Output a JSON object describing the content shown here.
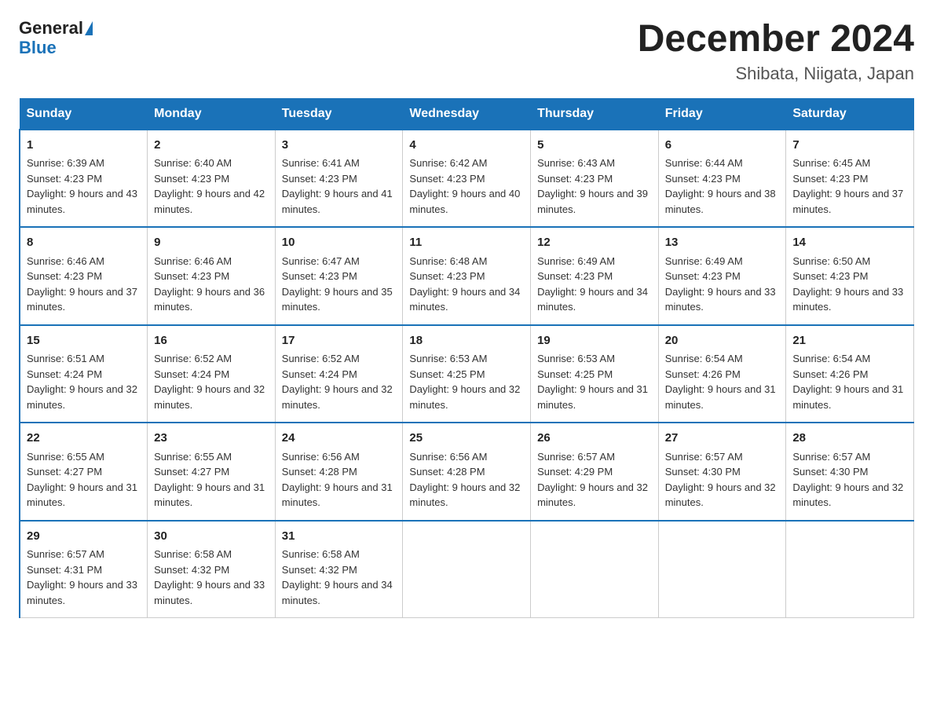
{
  "header": {
    "logo_general": "General",
    "logo_blue": "Blue",
    "title": "December 2024",
    "subtitle": "Shibata, Niigata, Japan"
  },
  "days_of_week": [
    "Sunday",
    "Monday",
    "Tuesday",
    "Wednesday",
    "Thursday",
    "Friday",
    "Saturday"
  ],
  "weeks": [
    [
      {
        "day": "1",
        "sunrise": "6:39 AM",
        "sunset": "4:23 PM",
        "daylight": "9 hours and 43 minutes."
      },
      {
        "day": "2",
        "sunrise": "6:40 AM",
        "sunset": "4:23 PM",
        "daylight": "9 hours and 42 minutes."
      },
      {
        "day": "3",
        "sunrise": "6:41 AM",
        "sunset": "4:23 PM",
        "daylight": "9 hours and 41 minutes."
      },
      {
        "day": "4",
        "sunrise": "6:42 AM",
        "sunset": "4:23 PM",
        "daylight": "9 hours and 40 minutes."
      },
      {
        "day": "5",
        "sunrise": "6:43 AM",
        "sunset": "4:23 PM",
        "daylight": "9 hours and 39 minutes."
      },
      {
        "day": "6",
        "sunrise": "6:44 AM",
        "sunset": "4:23 PM",
        "daylight": "9 hours and 38 minutes."
      },
      {
        "day": "7",
        "sunrise": "6:45 AM",
        "sunset": "4:23 PM",
        "daylight": "9 hours and 37 minutes."
      }
    ],
    [
      {
        "day": "8",
        "sunrise": "6:46 AM",
        "sunset": "4:23 PM",
        "daylight": "9 hours and 37 minutes."
      },
      {
        "day": "9",
        "sunrise": "6:46 AM",
        "sunset": "4:23 PM",
        "daylight": "9 hours and 36 minutes."
      },
      {
        "day": "10",
        "sunrise": "6:47 AM",
        "sunset": "4:23 PM",
        "daylight": "9 hours and 35 minutes."
      },
      {
        "day": "11",
        "sunrise": "6:48 AM",
        "sunset": "4:23 PM",
        "daylight": "9 hours and 34 minutes."
      },
      {
        "day": "12",
        "sunrise": "6:49 AM",
        "sunset": "4:23 PM",
        "daylight": "9 hours and 34 minutes."
      },
      {
        "day": "13",
        "sunrise": "6:49 AM",
        "sunset": "4:23 PM",
        "daylight": "9 hours and 33 minutes."
      },
      {
        "day": "14",
        "sunrise": "6:50 AM",
        "sunset": "4:23 PM",
        "daylight": "9 hours and 33 minutes."
      }
    ],
    [
      {
        "day": "15",
        "sunrise": "6:51 AM",
        "sunset": "4:24 PM",
        "daylight": "9 hours and 32 minutes."
      },
      {
        "day": "16",
        "sunrise": "6:52 AM",
        "sunset": "4:24 PM",
        "daylight": "9 hours and 32 minutes."
      },
      {
        "day": "17",
        "sunrise": "6:52 AM",
        "sunset": "4:24 PM",
        "daylight": "9 hours and 32 minutes."
      },
      {
        "day": "18",
        "sunrise": "6:53 AM",
        "sunset": "4:25 PM",
        "daylight": "9 hours and 32 minutes."
      },
      {
        "day": "19",
        "sunrise": "6:53 AM",
        "sunset": "4:25 PM",
        "daylight": "9 hours and 31 minutes."
      },
      {
        "day": "20",
        "sunrise": "6:54 AM",
        "sunset": "4:26 PM",
        "daylight": "9 hours and 31 minutes."
      },
      {
        "day": "21",
        "sunrise": "6:54 AM",
        "sunset": "4:26 PM",
        "daylight": "9 hours and 31 minutes."
      }
    ],
    [
      {
        "day": "22",
        "sunrise": "6:55 AM",
        "sunset": "4:27 PM",
        "daylight": "9 hours and 31 minutes."
      },
      {
        "day": "23",
        "sunrise": "6:55 AM",
        "sunset": "4:27 PM",
        "daylight": "9 hours and 31 minutes."
      },
      {
        "day": "24",
        "sunrise": "6:56 AM",
        "sunset": "4:28 PM",
        "daylight": "9 hours and 31 minutes."
      },
      {
        "day": "25",
        "sunrise": "6:56 AM",
        "sunset": "4:28 PM",
        "daylight": "9 hours and 32 minutes."
      },
      {
        "day": "26",
        "sunrise": "6:57 AM",
        "sunset": "4:29 PM",
        "daylight": "9 hours and 32 minutes."
      },
      {
        "day": "27",
        "sunrise": "6:57 AM",
        "sunset": "4:30 PM",
        "daylight": "9 hours and 32 minutes."
      },
      {
        "day": "28",
        "sunrise": "6:57 AM",
        "sunset": "4:30 PM",
        "daylight": "9 hours and 32 minutes."
      }
    ],
    [
      {
        "day": "29",
        "sunrise": "6:57 AM",
        "sunset": "4:31 PM",
        "daylight": "9 hours and 33 minutes."
      },
      {
        "day": "30",
        "sunrise": "6:58 AM",
        "sunset": "4:32 PM",
        "daylight": "9 hours and 33 minutes."
      },
      {
        "day": "31",
        "sunrise": "6:58 AM",
        "sunset": "4:32 PM",
        "daylight": "9 hours and 34 minutes."
      },
      null,
      null,
      null,
      null
    ]
  ]
}
